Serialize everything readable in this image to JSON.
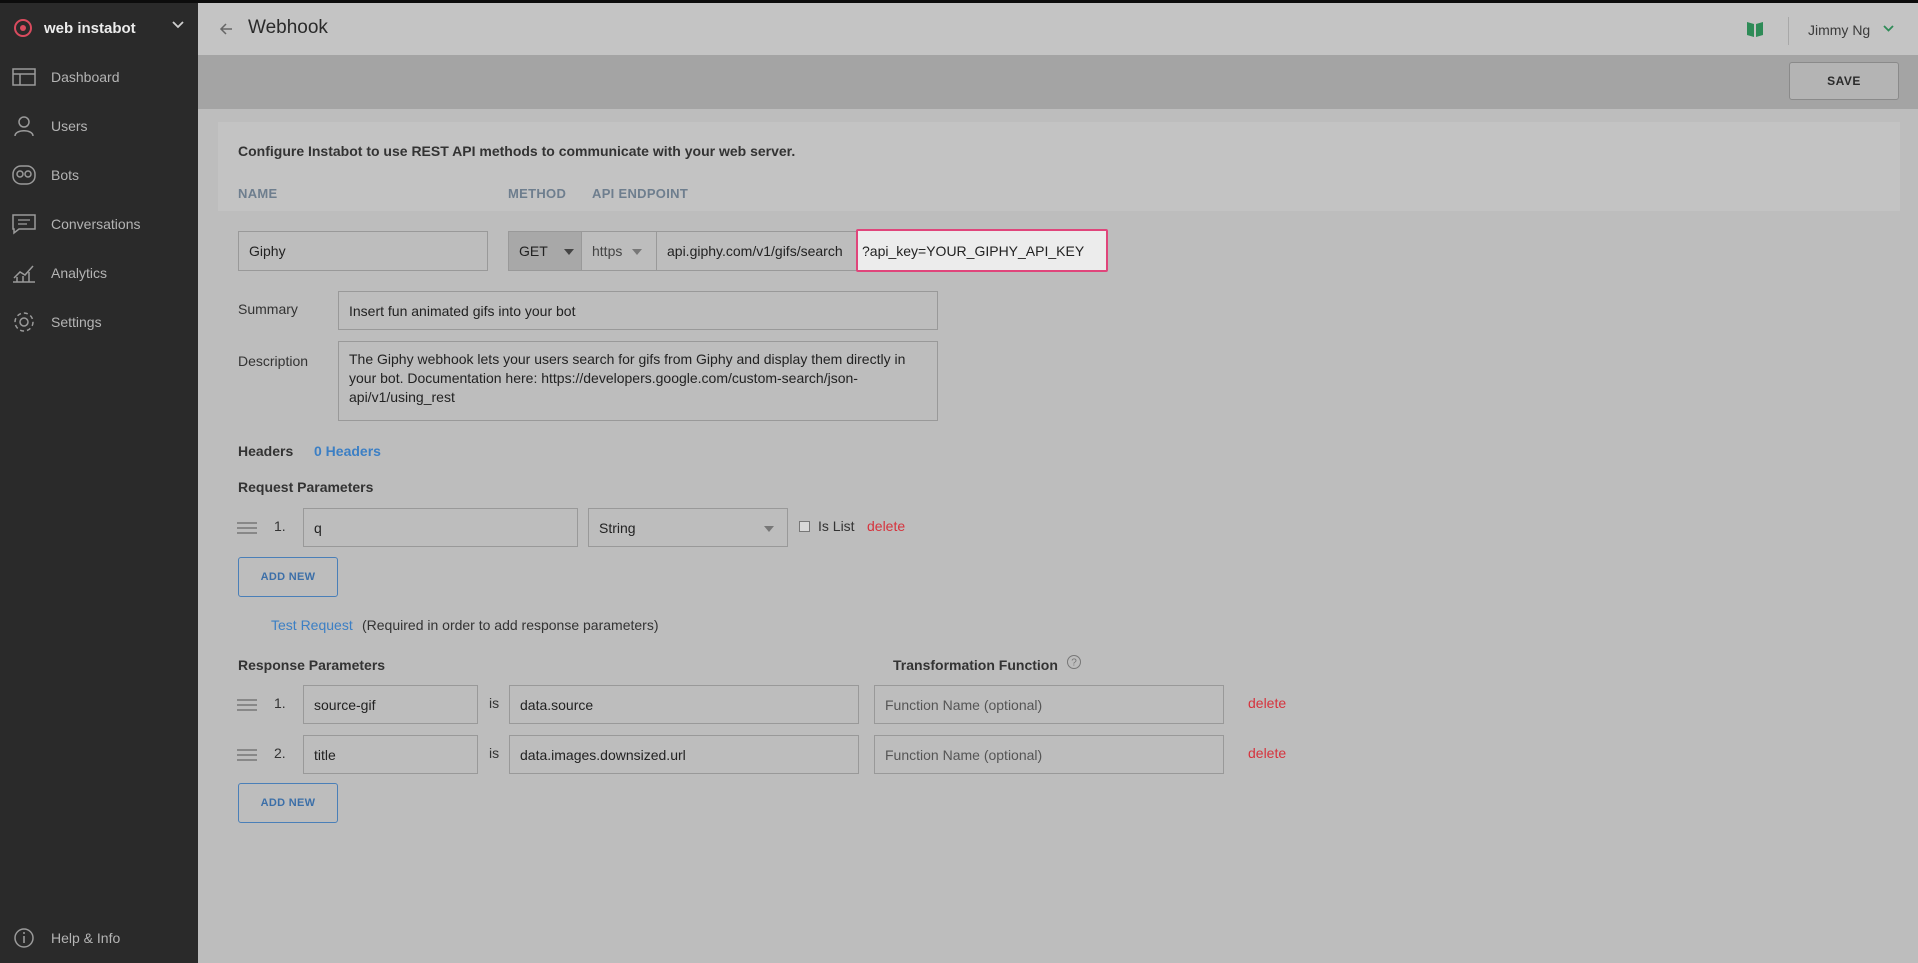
{
  "sidebar": {
    "brand": "web instabot",
    "items": [
      {
        "label": "Dashboard",
        "icon": "dashboard-icon"
      },
      {
        "label": "Users",
        "icon": "user-icon"
      },
      {
        "label": "Bots",
        "icon": "bot-icon"
      },
      {
        "label": "Conversations",
        "icon": "chat-icon"
      },
      {
        "label": "Analytics",
        "icon": "analytics-icon"
      },
      {
        "label": "Settings",
        "icon": "gear-icon"
      }
    ],
    "help": "Help & Info"
  },
  "header": {
    "title": "Webhook",
    "user": "Jimmy Ng"
  },
  "toolbar": {
    "save_label": "SAVE"
  },
  "intro": "Configure Instabot to use REST API methods to communicate with your web server.",
  "columns": {
    "name": "NAME",
    "method": "METHOD",
    "endpoint": "API ENDPOINT"
  },
  "form": {
    "name": "Giphy",
    "method": "GET",
    "protocol": "https",
    "endpoint_base": "api.giphy.com/v1/gifs/search",
    "endpoint_query": "?api_key=YOUR_GIPHY_API_KEY",
    "summary_label": "Summary",
    "summary": "Insert fun animated gifs into your bot",
    "description_label": "Description",
    "description": "The Giphy webhook lets your users search for gifs from Giphy and display them directly in your bot. Documentation here: https://developers.google.com/custom-search/json-api/v1/using_rest"
  },
  "headers": {
    "label": "Headers",
    "link": "0 Headers"
  },
  "request": {
    "title": "Request Parameters",
    "params": [
      {
        "num": "1.",
        "name": "q",
        "type": "String",
        "is_list_label": "Is List",
        "delete": "delete"
      }
    ],
    "add_new": "ADD NEW"
  },
  "test": {
    "link": "Test Request",
    "note": "(Required in order to add response parameters)"
  },
  "response": {
    "title": "Response Parameters",
    "transform_title": "Transformation Function",
    "is": "is",
    "fn_placeholder": "Function Name (optional)",
    "params": [
      {
        "num": "1.",
        "name": "source-gif",
        "path": "data.source",
        "delete": "delete"
      },
      {
        "num": "2.",
        "name": "title",
        "path": "data.images.downsized.url",
        "delete": "delete"
      }
    ],
    "add_new": "ADD NEW"
  }
}
